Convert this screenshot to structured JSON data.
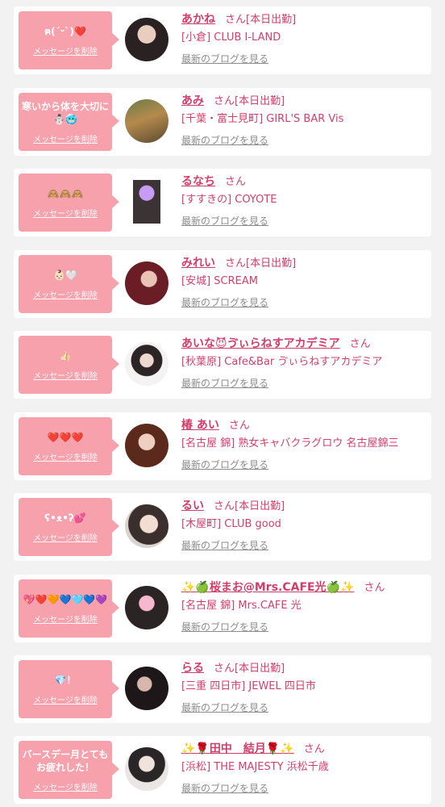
{
  "delete_label": "メッセージを削除",
  "blog_label": "最新のブログを見る",
  "colors": {
    "accent": "#d23e6a",
    "bubble": "#f7a1ad",
    "muted": "#8c8c8c"
  },
  "items": [
    {
      "message": "ฅ(ˊᵕˋ)❤️",
      "name": "あかね",
      "suffix": "さん[本日出勤]",
      "shop": "[小倉] CLUB I-LAND"
    },
    {
      "message": "寒いから体を大切に☃️🥶",
      "name": "あみ",
      "suffix": "さん[本日出勤]",
      "shop": "[千葉・富士見町] GIRL'S BAR Vis"
    },
    {
      "message": "🙈🙈🙈",
      "name": "るなち",
      "suffix": "さん",
      "shop": "[すすきの] COYOTE"
    },
    {
      "message": "👶🏻🤍",
      "name": "みれい",
      "suffix": "さん[本日出勤]",
      "shop": "[安城] SCREAM"
    },
    {
      "message": "👍🏻",
      "name": "あいな😈ゔぃらねすアカデミア",
      "suffix": "さん",
      "shop": "[秋葉原] Cafe&Bar ゔぃらねすアカデミア"
    },
    {
      "message": "❤️❤️❤️",
      "name": "椿 あい",
      "suffix": "さん",
      "shop": "[名古屋 錦] 熟女キャバクラグロウ 名古屋錦三"
    },
    {
      "message": "ʕ•ᴥ•ʔ💕",
      "name": "るい",
      "suffix": "さん[本日出勤]",
      "shop": "[木屋町] CLUB good"
    },
    {
      "message": "💖❤️🧡💙🩵💙💜",
      "name": "✨🍏桜まお@Mrs.CAFE光🍏✨",
      "suffix": "さん",
      "shop": "[名古屋 錦] Mrs.CAFE 光"
    },
    {
      "message": "💎！",
      "name": "らる",
      "suffix": "さん[本日出勤]",
      "shop": "[三重 四日市] JEWEL 四日市"
    },
    {
      "message": "バースデー月とてもお疲れした！",
      "name": "✨🌹田中　結月🌹✨",
      "suffix": "さん",
      "shop": "[浜松] THE MAJESTY 浜松千歳"
    }
  ]
}
